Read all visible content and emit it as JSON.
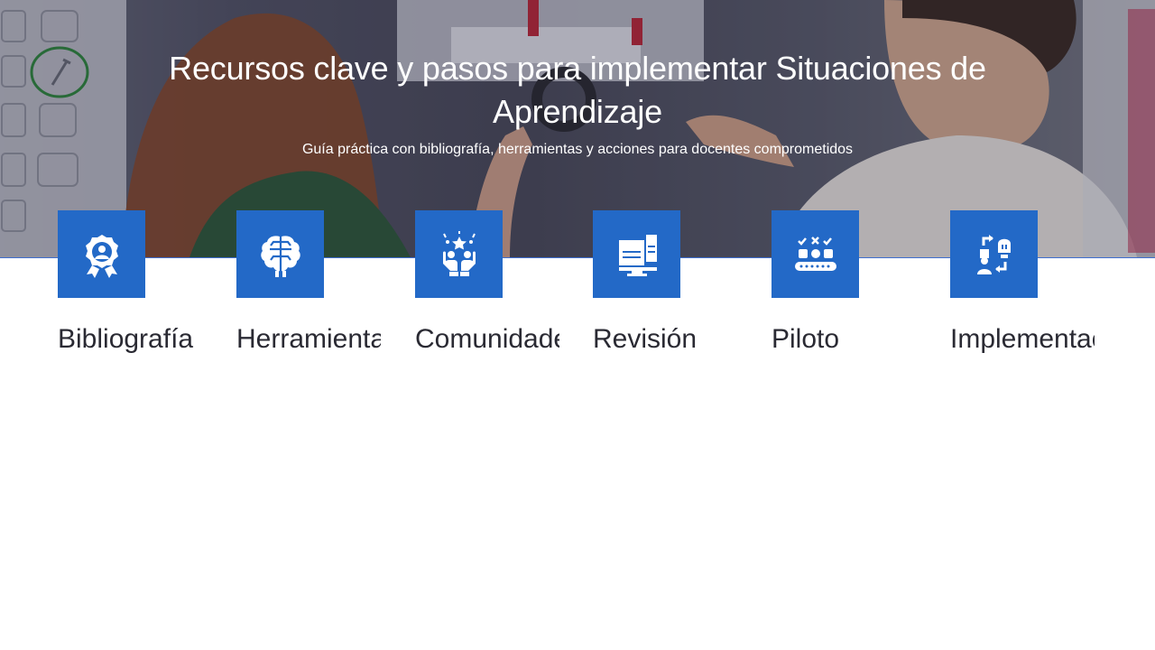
{
  "hero": {
    "title": "Recursos clave y pasos para implementar Situaciones de Aprendizaje",
    "subtitle": "Guía práctica con bibliografía, herramientas y acciones para docentes comprometidos"
  },
  "cards": [
    {
      "label": "Bibliografía",
      "icon": "award-badge-icon"
    },
    {
      "label": "Herramientas",
      "icon": "brain-circuit-icon"
    },
    {
      "label": "Comunidades",
      "icon": "hands-community-icon"
    },
    {
      "label": "Revisión",
      "icon": "monitor-documents-icon"
    },
    {
      "label": "Piloto",
      "icon": "conveyor-test-icon"
    },
    {
      "label": "Implementación",
      "icon": "deploy-exchange-icon"
    }
  ],
  "colors": {
    "accent": "#2369c7",
    "label_text": "#2a2a33",
    "hero_text": "#ffffff"
  }
}
